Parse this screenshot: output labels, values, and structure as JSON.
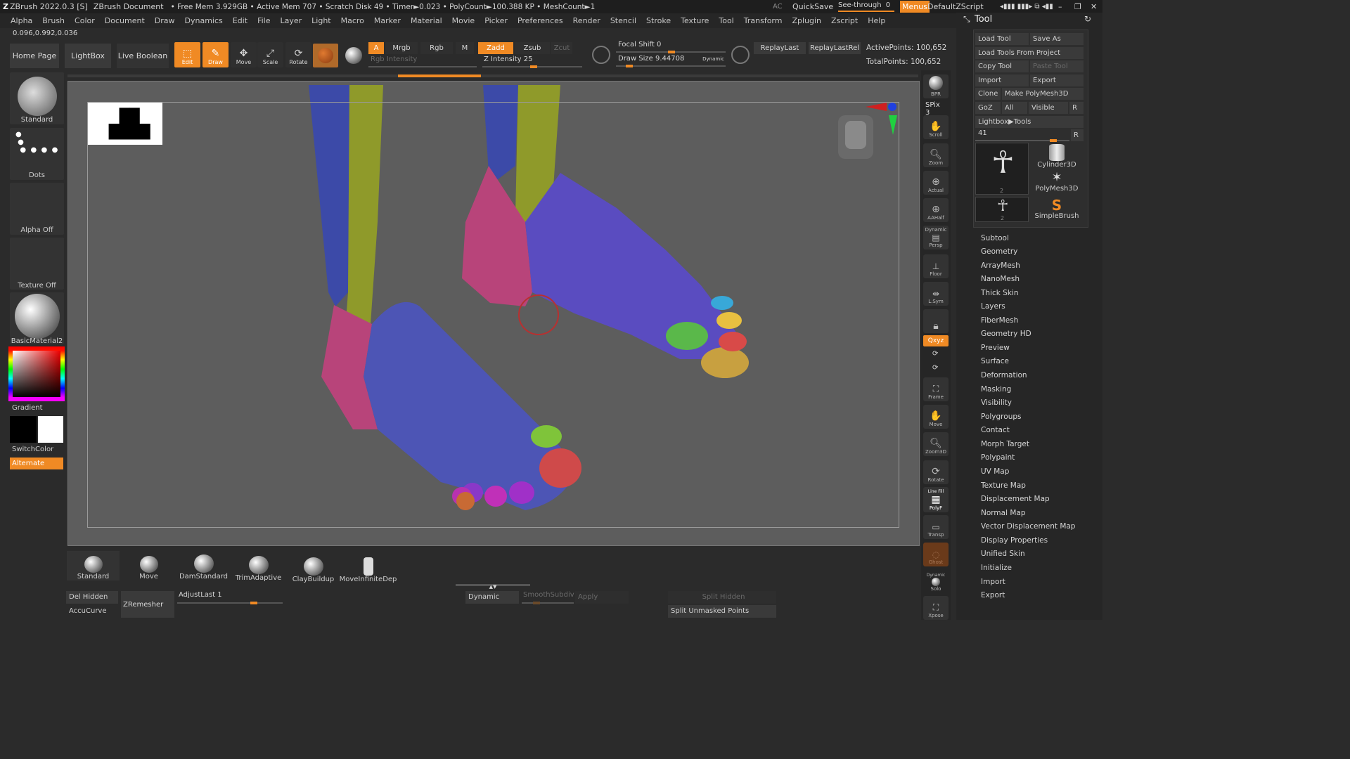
{
  "title_bar": {
    "app": "ZBrush 2022.0.3 [S]",
    "document": "ZBrush Document",
    "stats": "• Free Mem 3.929GB • Active Mem 707 • Scratch Disk 49 • Timer►0.023 • PolyCount►100.388 KP • MeshCount►1",
    "ac": "AC",
    "quicksave": "QuickSave",
    "seethrough": "See-through",
    "seethrough_value": "0",
    "menus": "Menus",
    "script": "DefaultZScript"
  },
  "menu": [
    "Alpha",
    "Brush",
    "Color",
    "Document",
    "Draw",
    "Dynamics",
    "Edit",
    "File",
    "Layer",
    "Light",
    "Macro",
    "Marker",
    "Material",
    "Movie",
    "Picker",
    "Preferences",
    "Render",
    "Stencil",
    "Stroke",
    "Texture",
    "Tool",
    "Transform",
    "Zplugin",
    "Zscript",
    "Help"
  ],
  "coords": "0.096,0.992,0.036",
  "shelf": {
    "home": "Home Page",
    "lightbox": "LightBox",
    "live_boolean": "Live Boolean",
    "edit": "Edit",
    "draw": "Draw",
    "move": "Move",
    "scale": "Scale",
    "rotate": "Rotate",
    "a": "A",
    "mrgb": "Mrgb",
    "rgb": "Rgb",
    "m": "M",
    "rgb_intensity": "Rgb Intensity",
    "zadd": "Zadd",
    "zsub": "Zsub",
    "zcut": "Zcut",
    "z_intensity": "Z Intensity 25",
    "focal_shift": "Focal Shift 0",
    "draw_size": "Draw Size 9.44708",
    "dynamic": "Dynamic",
    "replaylast": "ReplayLast",
    "replaylastrel": "ReplayLastRel",
    "active_points": "ActivePoints: 100,652",
    "total_points": "TotalPoints: 100,652"
  },
  "left": {
    "brush": "Standard",
    "stroke": "Dots",
    "alpha": "Alpha Off",
    "texture": "Texture Off",
    "material": "BasicMaterial2",
    "gradient": "Gradient",
    "switchcolor": "SwitchColor",
    "alternate": "Alternate"
  },
  "right": {
    "bpr": "BPR",
    "spix": "SPix 3",
    "scroll": "Scroll",
    "zoom": "Zoom",
    "actual": "Actual",
    "aahalf": "AAHalf",
    "persp": "Persp",
    "dynamic": "Dynamic",
    "floor": "Floor",
    "lsym": "L.Sym",
    "xyz": "Qxyz",
    "frame": "Frame",
    "move": "Move",
    "zoom3d": "Zoom3D",
    "rotate": "Rotate",
    "polyf": "PolyF",
    "linefill": "Line Fill",
    "transp": "Transp",
    "ghost": "Ghost",
    "solo": "Solo",
    "dynamic2": "Dynamic",
    "xpose": "Xpose"
  },
  "tool": {
    "header": "Tool",
    "load": "Load Tool",
    "saveas": "Save As",
    "load_project": "Load Tools From Project",
    "copy": "Copy Tool",
    "paste": "Paste Tool",
    "import": "Import",
    "export": "Export",
    "clone": "Clone",
    "make_poly": "Make PolyMesh3D",
    "goz": "GoZ",
    "all": "All",
    "visible": "Visible",
    "r": "R",
    "lightbox_tools": "Lightbox▶Tools",
    "slider_value": "41",
    "thumb_count1": "2",
    "thumb_count2": "2",
    "cyl": "Cylinder3D",
    "poly": "PolyMesh3D",
    "simple": "SimpleBrush",
    "subpalettes": [
      "Subtool",
      "Geometry",
      "ArrayMesh",
      "NanoMesh",
      "Thick Skin",
      "Layers",
      "FiberMesh",
      "Geometry HD",
      "Preview",
      "Surface",
      "Deformation",
      "Masking",
      "Visibility",
      "Polygroups",
      "Contact",
      "Morph Target",
      "Polypaint",
      "UV Map",
      "Texture Map",
      "Displacement Map",
      "Normal Map",
      "Vector Displacement Map",
      "Display Properties",
      "Unified Skin",
      "Initialize",
      "Import",
      "Export"
    ]
  },
  "bottom": {
    "brushes": [
      "Standard",
      "Move",
      "DamStandard",
      "TrimAdaptive",
      "ClayBuildup",
      "MoveInfiniteDep"
    ],
    "del_hidden": "Del Hidden",
    "zremesher": "ZRemesher",
    "accucurve": "AccuCurve",
    "adjustlast": "AdjustLast 1",
    "dynamic": "Dynamic",
    "smoothsubdiv": "SmoothSubdiv",
    "apply": "Apply",
    "split_hidden": "Split Hidden",
    "split_unmasked": "Split Unmasked Points"
  }
}
